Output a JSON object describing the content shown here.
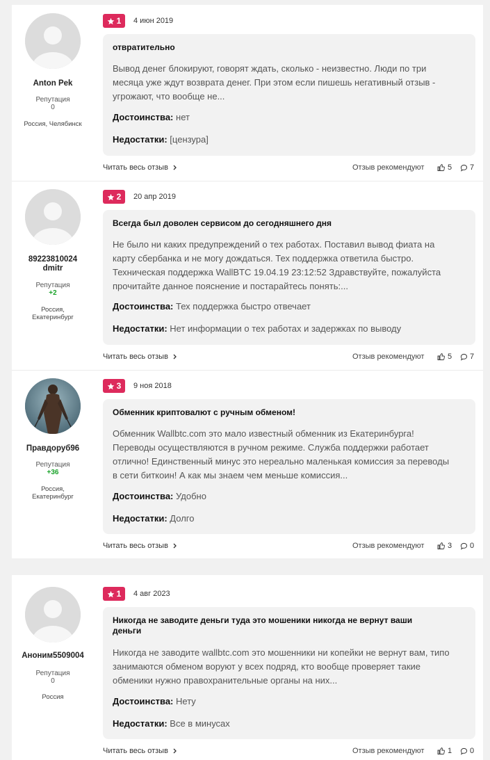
{
  "labels": {
    "reputation": "Репутация",
    "pros": "Достоинства:",
    "cons": "Недостатки:",
    "read_more": "Читать весь отзыв",
    "recommend": "Отзыв рекомендуют"
  },
  "reviews": [
    {
      "author": "Anton Pek",
      "author_line2": "",
      "reputation": "0",
      "location_1": "Россия, Челябинск",
      "location_2": "",
      "rating": "1",
      "date": "4 июн 2019",
      "title": "отвратительно",
      "title_2": "",
      "text_lines": [
        "Вывод денег блокируют, говорят ждать, сколько - неизвестно. Люди по три",
        "месяца уже ждут возврата денег. При этом если пишешь негативный отзыв -",
        "угрожают, что вообще не..."
      ],
      "pros": "нет",
      "cons": "[цензура]",
      "likes": "5",
      "comments": "7"
    },
    {
      "author": "89223810024",
      "author_line2": "dmitr",
      "reputation": "+2",
      "location_1": "Россия,",
      "location_2": "Екатеринбург",
      "rating": "2",
      "date": "20 апр 2019",
      "title": "Всегда был доволен сервисом до сегодняшнего дня",
      "title_2": "",
      "text_lines": [
        "Не было ни каких предупреждений о тех работах. Поставил вывод фиата на",
        "карту сбербанка и не могу дождаться. Тех поддержка ответила быстро.",
        "Техническая поддержка WallBTC 19.04.19 23:12:52 Здравствуйте, пожалуйста",
        "прочитайте данное пояснение и постарайтесь понять:..."
      ],
      "pros": "Тех поддержка быстро отвечает",
      "cons": "Нет информации о тех работах и задержках по выводу",
      "likes": "5",
      "comments": "7"
    },
    {
      "author": "Правдоруб96",
      "author_line2": "",
      "reputation": "+36",
      "location_1": "Россия,",
      "location_2": "Екатеринбург",
      "rating": "3",
      "date": "9 ноя 2018",
      "title": "Обменник криптовалют с ручным обменом!",
      "title_2": "",
      "text_lines": [
        "Обменник Wallbtc.com это мало известный обменник из Екатеринбурга!",
        "Переводы осуществляются в ручном режиме. Служба поддержки работает",
        "отлично! Единственный минус это нереально маленькая комиссия за переводы",
        "в сети биткоин! А как мы знаем чем меньше комиссия..."
      ],
      "pros": "Удобно",
      "cons": "Долго",
      "likes": "3",
      "comments": "0"
    },
    {
      "author": "Аноним5509004",
      "author_line2": "",
      "reputation": "0",
      "location_1": "Россия",
      "location_2": "",
      "rating": "1",
      "date": "4 авг 2023",
      "title": "Никогда не заводите деньги туда это мошеники никогда не вернут ваши",
      "title_2": "деньги",
      "text_lines": [
        "Никогда не заводите wallbtc.com это мошенники ни копейки не вернут вам, типо",
        "занимаются обменом воруют у всех подряд, кто вообще проверяет такие",
        "обменики нужно правохранительные органы на них..."
      ],
      "pros": "Нету",
      "cons": "Все в минусах",
      "likes": "1",
      "comments": "0"
    }
  ]
}
